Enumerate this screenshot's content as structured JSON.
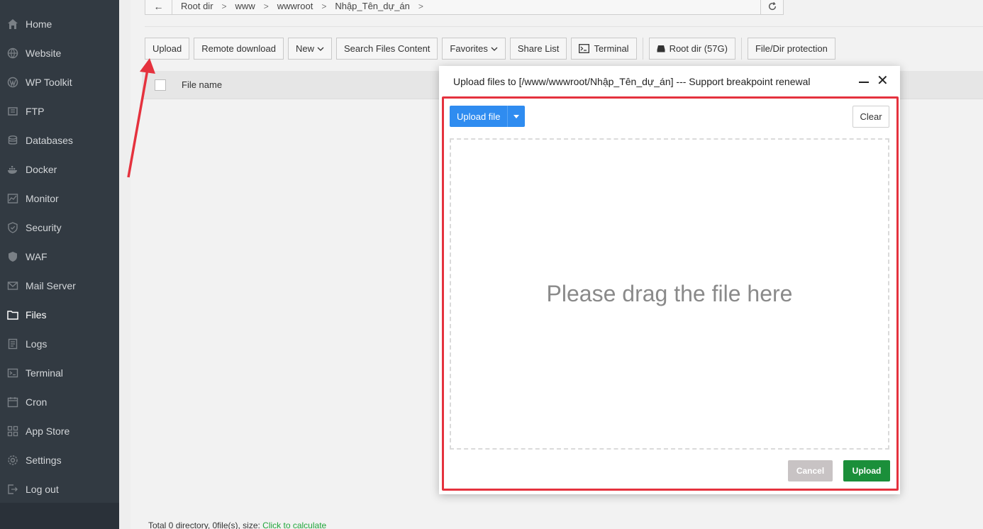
{
  "sidebar": {
    "items": [
      {
        "label": "Home",
        "icon": "home-icon"
      },
      {
        "label": "Website",
        "icon": "globe-icon"
      },
      {
        "label": "WP Toolkit",
        "icon": "wordpress-icon"
      },
      {
        "label": "FTP",
        "icon": "ftp-icon"
      },
      {
        "label": "Databases",
        "icon": "database-icon"
      },
      {
        "label": "Docker",
        "icon": "docker-icon"
      },
      {
        "label": "Monitor",
        "icon": "monitor-icon"
      },
      {
        "label": "Security",
        "icon": "shield-icon"
      },
      {
        "label": "WAF",
        "icon": "waf-icon"
      },
      {
        "label": "Mail Server",
        "icon": "mail-icon"
      },
      {
        "label": "Files",
        "icon": "folder-icon",
        "active": true
      },
      {
        "label": "Logs",
        "icon": "logs-icon"
      },
      {
        "label": "Terminal",
        "icon": "terminal-icon"
      },
      {
        "label": "Cron",
        "icon": "calendar-icon"
      },
      {
        "label": "App Store",
        "icon": "apps-icon"
      },
      {
        "label": "Settings",
        "icon": "gear-icon"
      },
      {
        "label": "Log out",
        "icon": "logout-icon"
      }
    ]
  },
  "pathbar": {
    "back_icon": "←",
    "crumbs": [
      "Root dir",
      "www",
      "wwwroot",
      "Nhập_Tên_dự_án"
    ],
    "sep": ">",
    "refresh_icon": "refresh-icon"
  },
  "toolbar": {
    "upload": "Upload",
    "remote_download": "Remote download",
    "new": "New",
    "search_files": "Search Files Content",
    "favorites": "Favorites",
    "share_list": "Share List",
    "terminal": "Terminal",
    "root_dir": "Root dir (57G)",
    "protection": "File/Dir protection"
  },
  "table": {
    "filename_header": "File name"
  },
  "footer": {
    "info": "Total 0 directory, 0file(s), size:",
    "link": "Click to calculate"
  },
  "dialog": {
    "title": "Upload files to [/www/wwwroot/Nhập_Tên_dự_án] --- Support breakpoint renewal",
    "upload_file": "Upload file",
    "clear": "Clear",
    "drop_text": "Please drag the file here",
    "cancel": "Cancel",
    "upload": "Upload"
  },
  "colors": {
    "sidebar_bg": "#323a42",
    "primary_blue": "#2f8cf0",
    "upload_green": "#1b8f3a",
    "highlight_red": "#e5323e",
    "link_green": "#20a53a"
  }
}
